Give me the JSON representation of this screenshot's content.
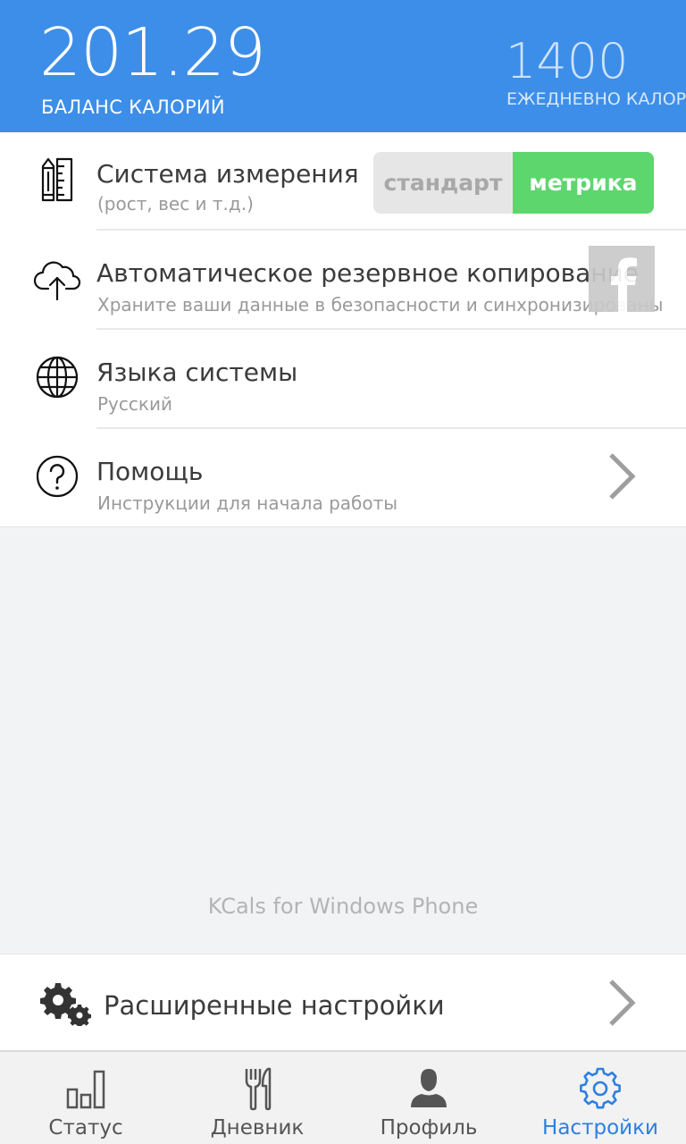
{
  "header": {
    "balance_value": "201.29",
    "balance_label": "БАЛАНС КАЛОРИЙ",
    "daily_value": "1400",
    "daily_label": "ЕЖЕДНЕВНО КАЛОРИЙ"
  },
  "settings": {
    "measurement": {
      "title": "Система измерения",
      "subtitle": "(рост, вес и т.д.)",
      "option_standard": "стандарт",
      "option_metric": "метрика",
      "selected": "метрика"
    },
    "backup": {
      "title": "Автоматическое резервное копирование",
      "subtitle": "Храните ваши данные в безопасности и синхронизированы"
    },
    "language": {
      "title": "Языка системы",
      "subtitle": "Русский"
    },
    "help": {
      "title": "Помощь",
      "subtitle": "Инструкции для начала работы"
    }
  },
  "footer_text": "KCals for Windows Phone",
  "advanced": {
    "label": "Расширенные настройки"
  },
  "tabs": [
    {
      "label": "Статус",
      "icon": "bar-chart-icon"
    },
    {
      "label": "Дневник",
      "icon": "fork-knife-icon"
    },
    {
      "label": "Профиль",
      "icon": "person-icon"
    },
    {
      "label": "Настройки",
      "icon": "gear-icon",
      "active": true
    }
  ],
  "colors": {
    "header": "#3d8ee8",
    "metric_active": "#5dd66e",
    "tab_active": "#2d7fe0"
  }
}
